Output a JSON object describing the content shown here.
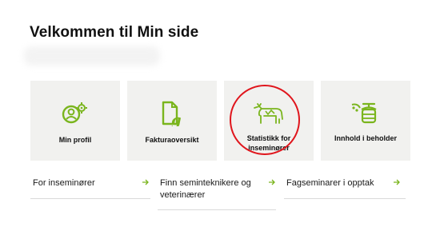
{
  "page": {
    "title": "Velkommen til Min side"
  },
  "cards": [
    {
      "label": "Min profil",
      "icon": "user-settings-icon"
    },
    {
      "label": "Fakturaoversikt",
      "icon": "invoice-icon"
    },
    {
      "label": "Statistikk for inseminører",
      "icon": "cow-icon"
    },
    {
      "label": "Innhold i beholder",
      "icon": "container-icon"
    }
  ],
  "links": [
    {
      "label": "For inseminører",
      "icon": "arrow-right-icon"
    },
    {
      "label": "Finn seminteknikere og veterinærer",
      "icon": "arrow-right-icon"
    },
    {
      "label": "Fagseminarer i opptak",
      "icon": "arrow-right-icon"
    }
  ],
  "colors": {
    "accent": "#7ab51d",
    "highlight": "#e0151c",
    "card_bg": "#f1f1ef"
  }
}
